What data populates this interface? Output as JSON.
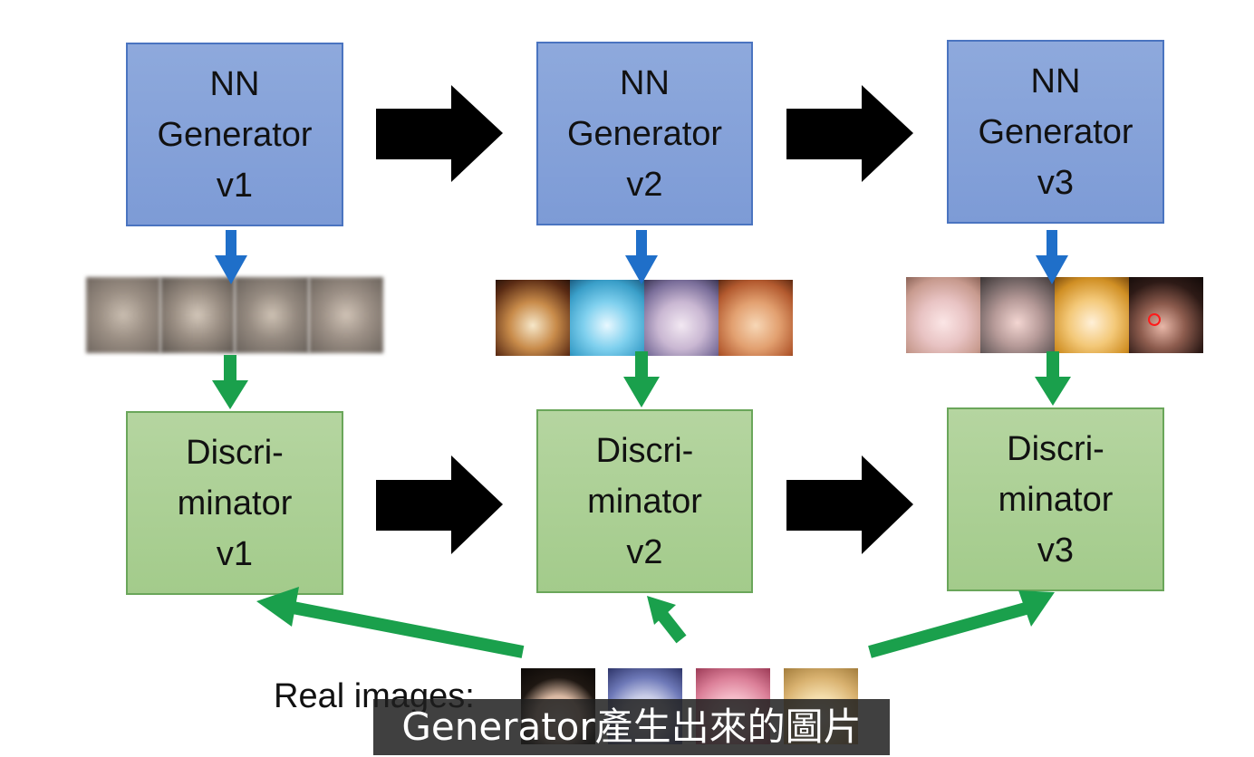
{
  "generators": [
    {
      "lines": [
        "NN",
        "Generator",
        "v1"
      ]
    },
    {
      "lines": [
        "NN",
        "Generator",
        "v2"
      ]
    },
    {
      "lines": [
        "NN",
        "Generator",
        "v3"
      ]
    }
  ],
  "discriminators": [
    {
      "lines": [
        "Discri-",
        "minator",
        "v1"
      ]
    },
    {
      "lines": [
        "Discri-",
        "minator",
        "v2"
      ]
    },
    {
      "lines": [
        "Discri-",
        "minator",
        "v3"
      ]
    }
  ],
  "real_images_label": "Real images:",
  "subtitle": "Generator產生出來的圖片",
  "colors": {
    "generator_fill": "#7d9bd6",
    "discriminator_fill": "#a3cb8b",
    "blue_arrow": "#1f6fc9",
    "green_arrow": "#1aa04c",
    "black_arrow": "#000000"
  }
}
